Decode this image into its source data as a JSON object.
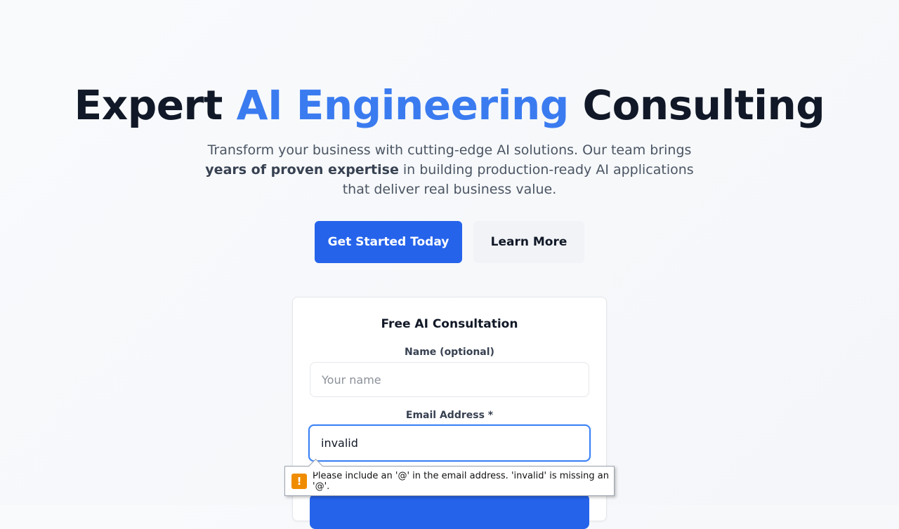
{
  "hero": {
    "title_part1": "Expert ",
    "title_accent": "AI Engineering",
    "title_part2": " Consulting",
    "subtitle_part1": "Transform your business with cutting-edge AI solutions. Our team brings ",
    "subtitle_bold": "years of proven expertise",
    "subtitle_part2": " in building production-ready AI applications that deliver real business value.",
    "primary_button": "Get Started Today",
    "secondary_button": "Learn More"
  },
  "form": {
    "title": "Free AI Consultation",
    "name_label": "Name (optional)",
    "name_placeholder": "Your name",
    "name_value": "",
    "email_label": "Email Address *",
    "email_value": "invalid"
  },
  "validation": {
    "icon": "warning-icon",
    "icon_glyph": "!",
    "message": "Please include an '@' in the email address. 'invalid' is missing an '@'."
  },
  "colors": {
    "accent": "#3b7bf0",
    "primary": "#2563eb",
    "warning": "#f08c00"
  }
}
